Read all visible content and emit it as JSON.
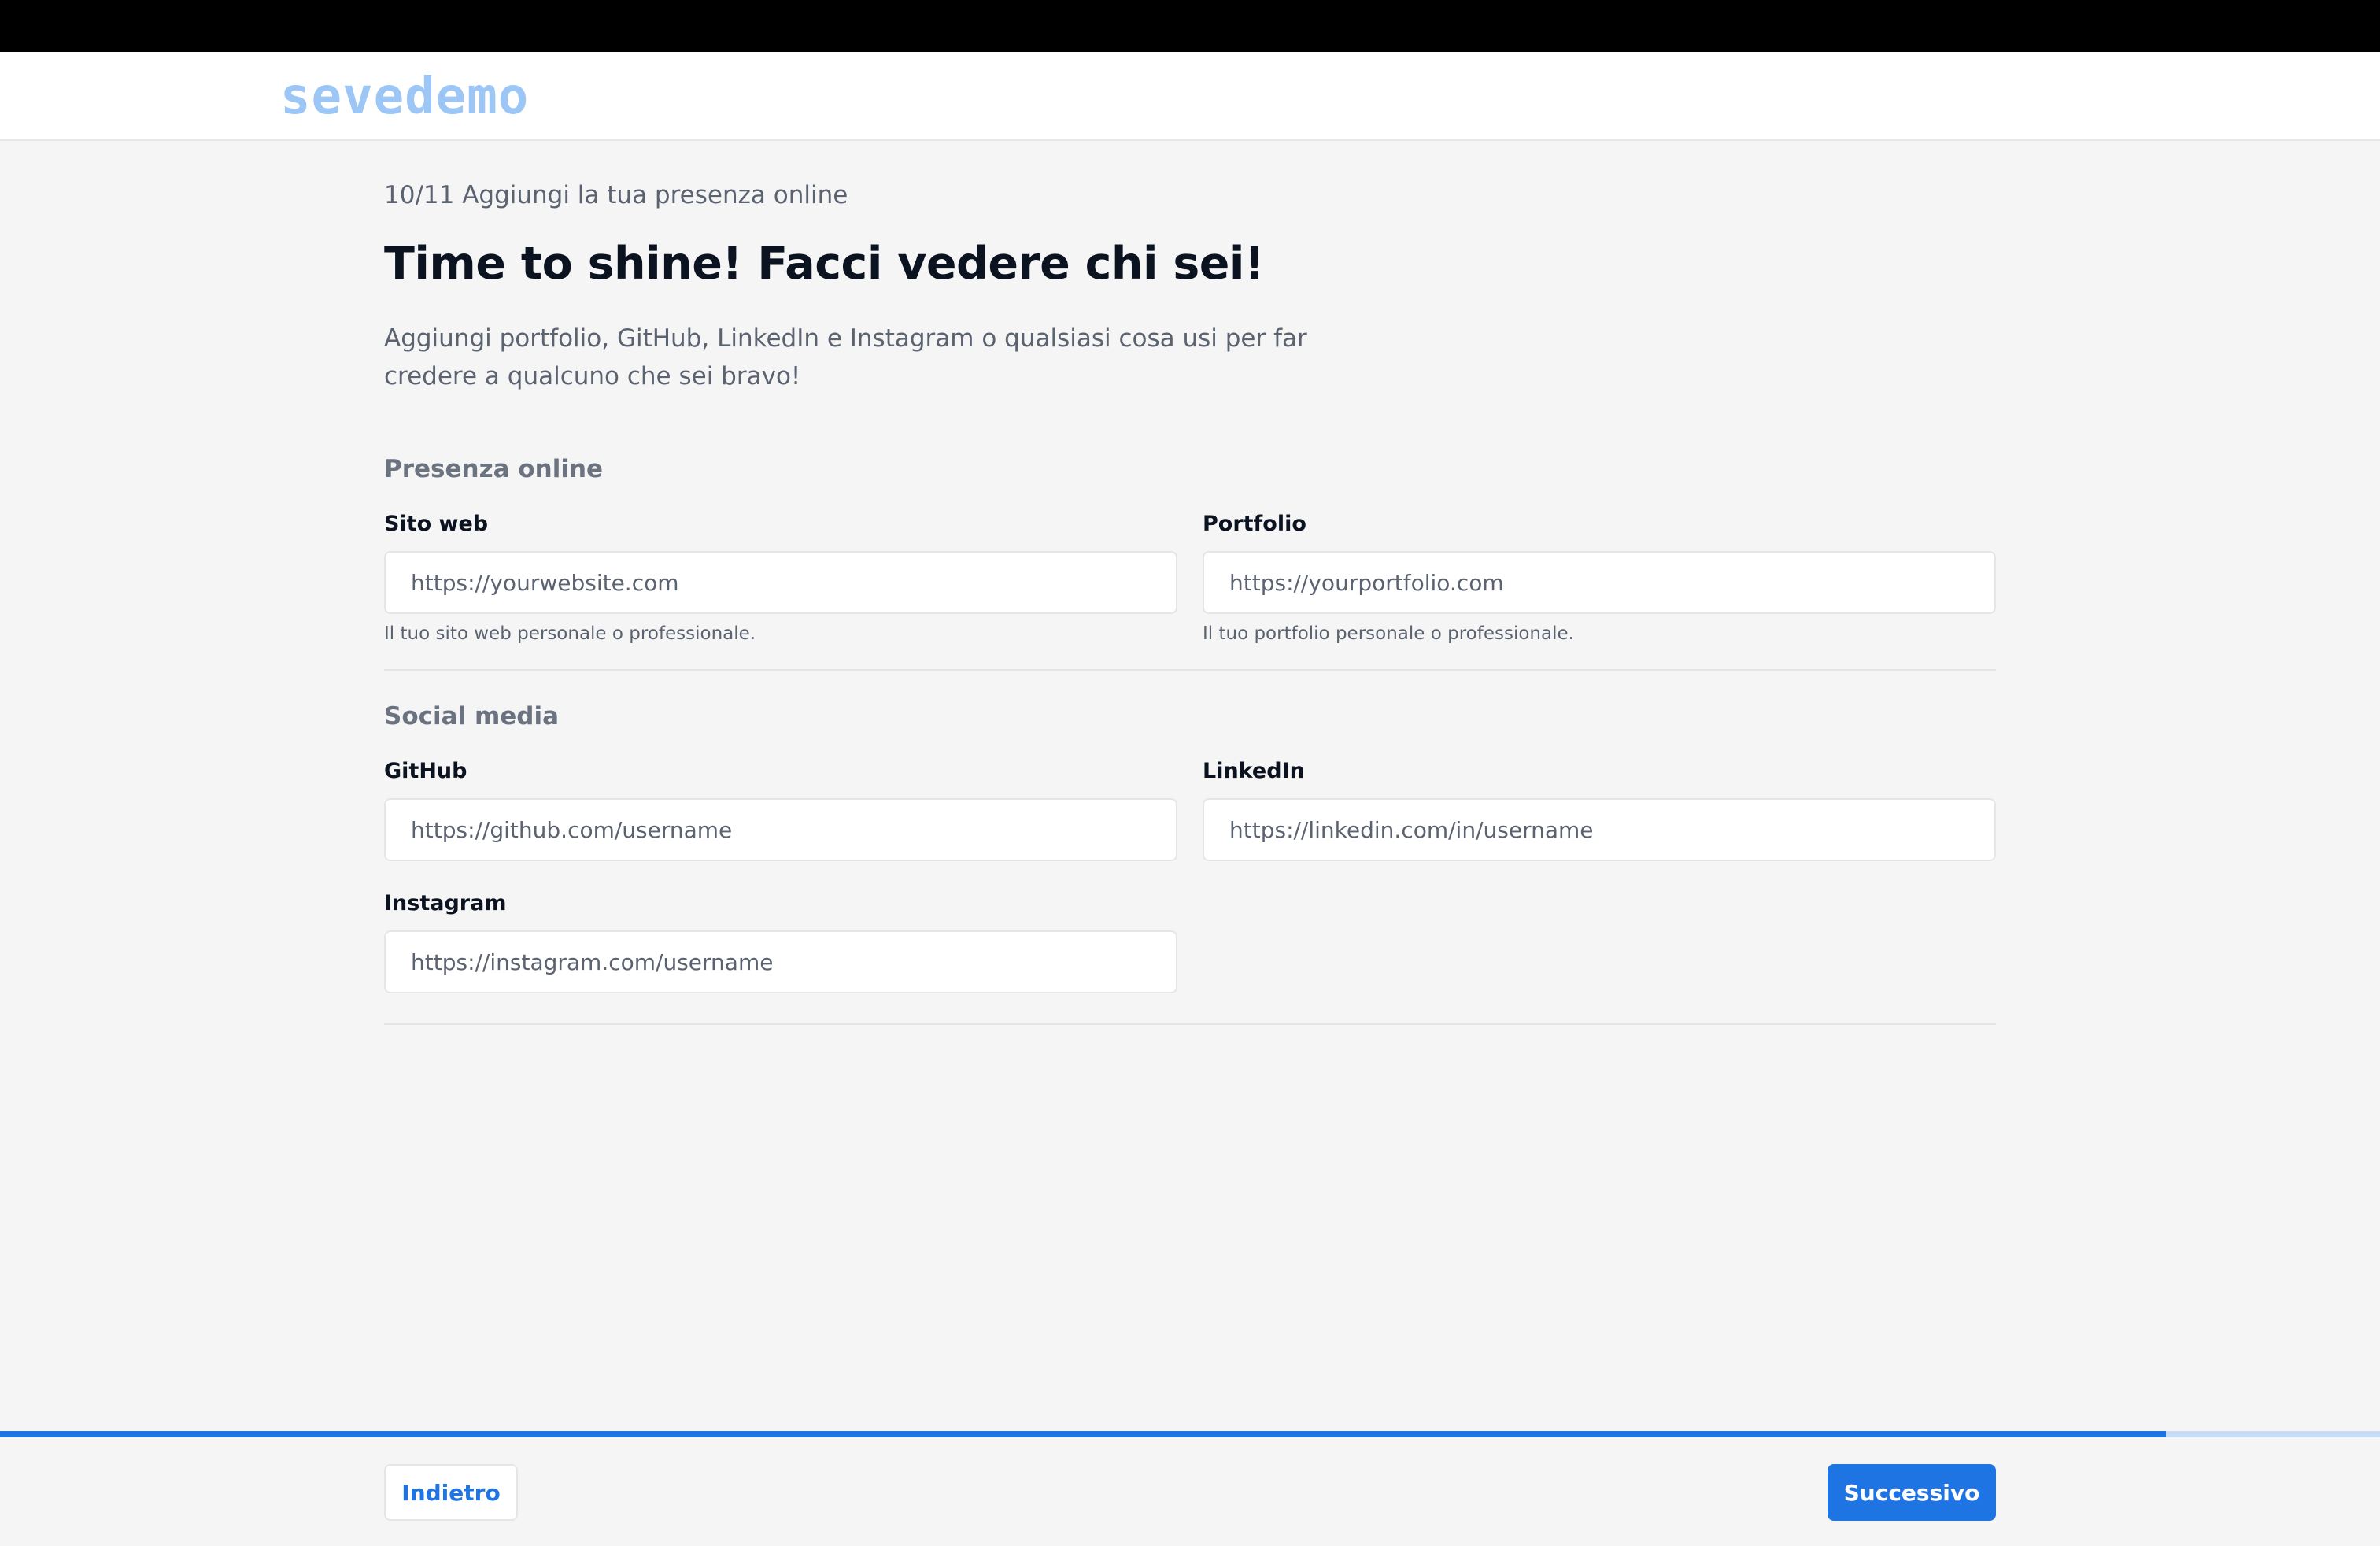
{
  "brand": {
    "logo_text": "sevedemo",
    "logo_color": "#9cc6f5"
  },
  "step": {
    "label": "10/11 Aggiungi la tua presenza online",
    "current": 10,
    "total": 11
  },
  "heading": {
    "title": "Time to shine! Facci vedere chi sei!",
    "description": "Aggiungi portfolio, GitHub, LinkedIn e Instagram o qualsiasi cosa usi per far credere a qualcuno che sei bravo!"
  },
  "sections": {
    "online": {
      "title": "Presenza online",
      "website": {
        "label": "Sito web",
        "placeholder": "https://yourwebsite.com",
        "value": "",
        "hint": "Il tuo sito web personale o professionale."
      },
      "portfolio": {
        "label": "Portfolio",
        "placeholder": "https://yourportfolio.com",
        "value": "",
        "hint": "Il tuo portfolio personale o professionale."
      }
    },
    "social": {
      "title": "Social media",
      "github": {
        "label": "GitHub",
        "placeholder": "https://github.com/username",
        "value": ""
      },
      "linkedin": {
        "label": "LinkedIn",
        "placeholder": "https://linkedin.com/in/username",
        "value": ""
      },
      "instagram": {
        "label": "Instagram",
        "placeholder": "https://instagram.com/username",
        "value": ""
      }
    }
  },
  "progress": {
    "fraction": 0.91
  },
  "footer": {
    "back_label": "Indietro",
    "next_label": "Successivo"
  },
  "colors": {
    "accent": "#1f74e4",
    "progress_track": "#c9dcf5",
    "background": "#f5f5f5"
  }
}
